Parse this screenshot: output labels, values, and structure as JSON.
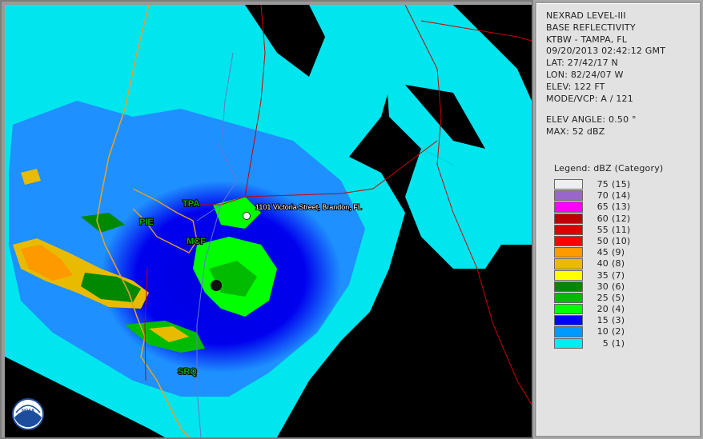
{
  "header": {
    "product": "NEXRAD LEVEL-III",
    "type": "BASE REFLECTIVITY",
    "station": "KTBW - TAMPA, FL",
    "datetime": "09/20/2013 02:42:12 GMT",
    "lat": "LAT: 27/42/17 N",
    "lon": "LON: 82/24/07 W",
    "elev": "ELEV: 122 FT",
    "mode": "MODE/VCP: A / 121"
  },
  "elevation": {
    "angle": "ELEV ANGLE: 0.50 °",
    "max": "MAX: 52 dBZ"
  },
  "legend": {
    "title": "Legend: dBZ (Category)",
    "entries": [
      {
        "dbz": "75",
        "cat": "(15)",
        "color": "#eeeeee"
      },
      {
        "dbz": "70",
        "cat": "(14)",
        "color": "#9966cc"
      },
      {
        "dbz": "65",
        "cat": "(13)",
        "color": "#ff00ff"
      },
      {
        "dbz": "60",
        "cat": "(12)",
        "color": "#bb0000"
      },
      {
        "dbz": "55",
        "cat": "(11)",
        "color": "#dd0000"
      },
      {
        "dbz": "50",
        "cat": "(10)",
        "color": "#ff0000"
      },
      {
        "dbz": "45",
        "cat": "(9)",
        "color": "#ff9900"
      },
      {
        "dbz": "40",
        "cat": "(8)",
        "color": "#e8bb00"
      },
      {
        "dbz": "35",
        "cat": "(7)",
        "color": "#ffff00"
      },
      {
        "dbz": "30",
        "cat": "(6)",
        "color": "#008800"
      },
      {
        "dbz": "25",
        "cat": "(5)",
        "color": "#00bb00"
      },
      {
        "dbz": "20",
        "cat": "(4)",
        "color": "#00ff00"
      },
      {
        "dbz": "15",
        "cat": "(3)",
        "color": "#0000ff"
      },
      {
        "dbz": "10",
        "cat": "(2)",
        "color": "#0099ff"
      },
      {
        "dbz": "5",
        "cat": "(1)",
        "color": "#00eeee"
      }
    ]
  },
  "map": {
    "marker_label": "1101 Victoria Street, Brandon, FL",
    "logo_text": "NOAA",
    "places": [
      {
        "id": "tpa",
        "label": "TPA"
      },
      {
        "id": "pie",
        "label": "PIE"
      },
      {
        "id": "mcf",
        "label": "MCF"
      },
      {
        "id": "srq",
        "label": "SRQ"
      }
    ]
  }
}
